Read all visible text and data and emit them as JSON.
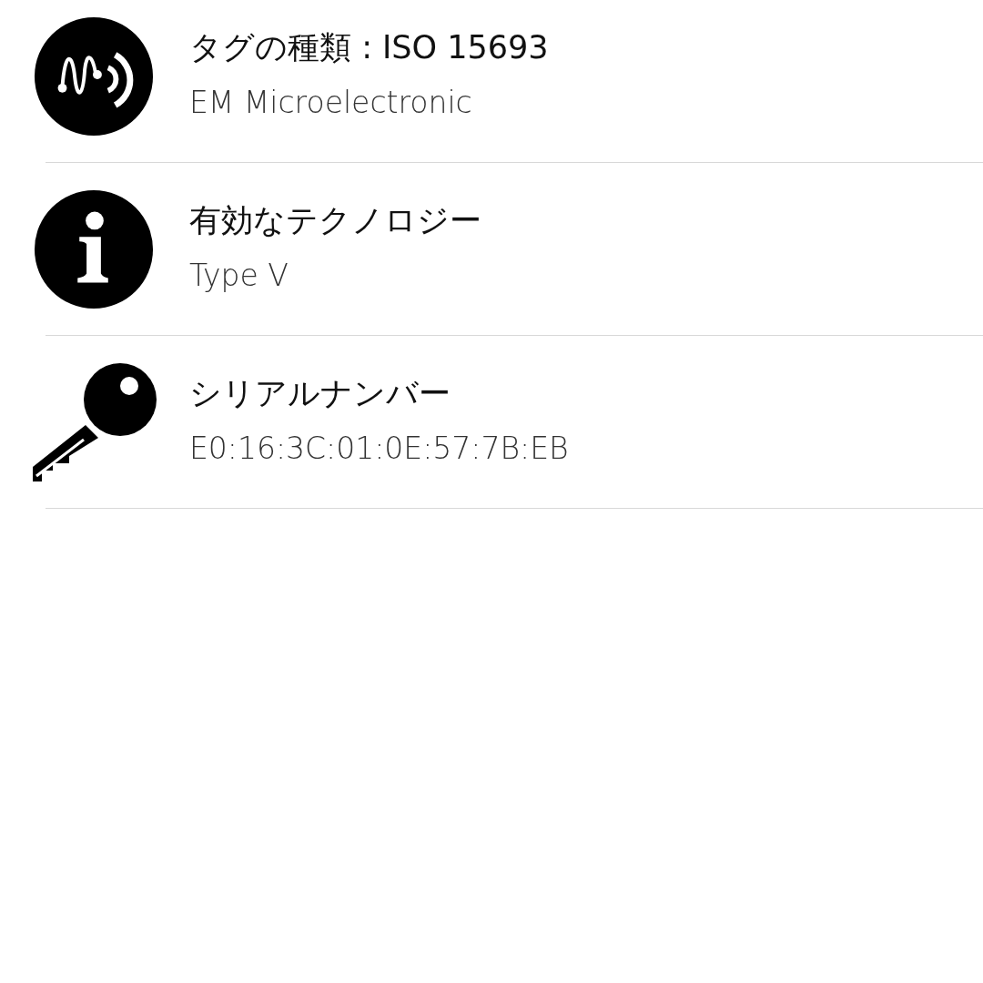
{
  "rows": [
    {
      "kind": "nfc",
      "title": "タグの種類 : ISO 15693",
      "subtitle": "EM Microelectronic"
    },
    {
      "kind": "info",
      "title": "有効なテクノロジー",
      "subtitle": "Type V"
    },
    {
      "kind": "key",
      "title": "シリアルナンバー",
      "subtitle": "E0:16:3C:01:0E:57:7B:EB"
    }
  ]
}
